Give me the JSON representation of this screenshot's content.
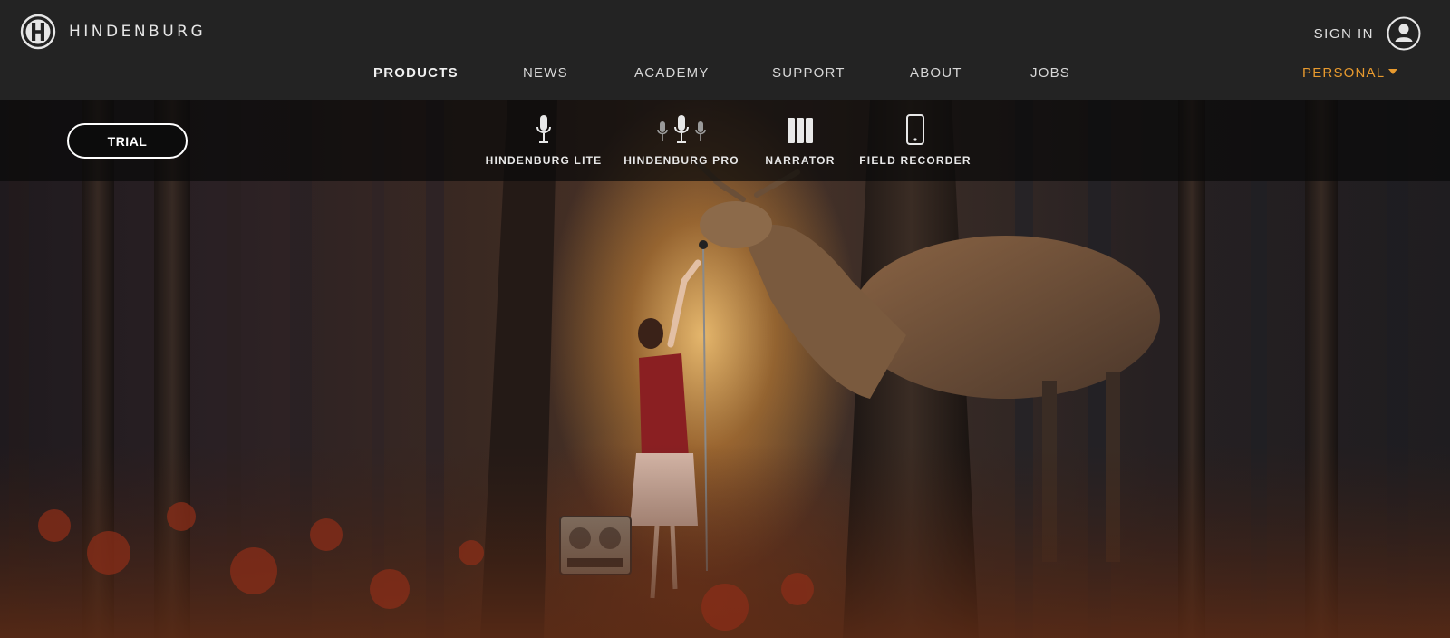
{
  "brand": {
    "name": "HINDENBURG",
    "logo_icon": "hindenburg-h-logo"
  },
  "account": {
    "sign_in_label": "SIGN IN",
    "icon": "user-icon"
  },
  "nav": {
    "items": [
      {
        "label": "PRODUCTS",
        "active": true
      },
      {
        "label": "NEWS"
      },
      {
        "label": "ACADEMY"
      },
      {
        "label": "SUPPORT"
      },
      {
        "label": "ABOUT"
      },
      {
        "label": "JOBS"
      }
    ],
    "segment": {
      "label": "PERSONAL",
      "color": "#e89a2e",
      "icon": "caret-down-icon"
    }
  },
  "product_bar": {
    "trial_label": "TRIAL",
    "products": [
      {
        "label": "HINDENBURG LITE",
        "icon": "microphone-icon"
      },
      {
        "label": "HINDENBURG PRO",
        "icon": "three-microphones-icon"
      },
      {
        "label": "NARRATOR",
        "icon": "books-icon"
      },
      {
        "label": "FIELD RECORDER",
        "icon": "smartphone-icon"
      }
    ]
  },
  "colors": {
    "header_bg": "#232323",
    "accent": "#e89a2e"
  }
}
